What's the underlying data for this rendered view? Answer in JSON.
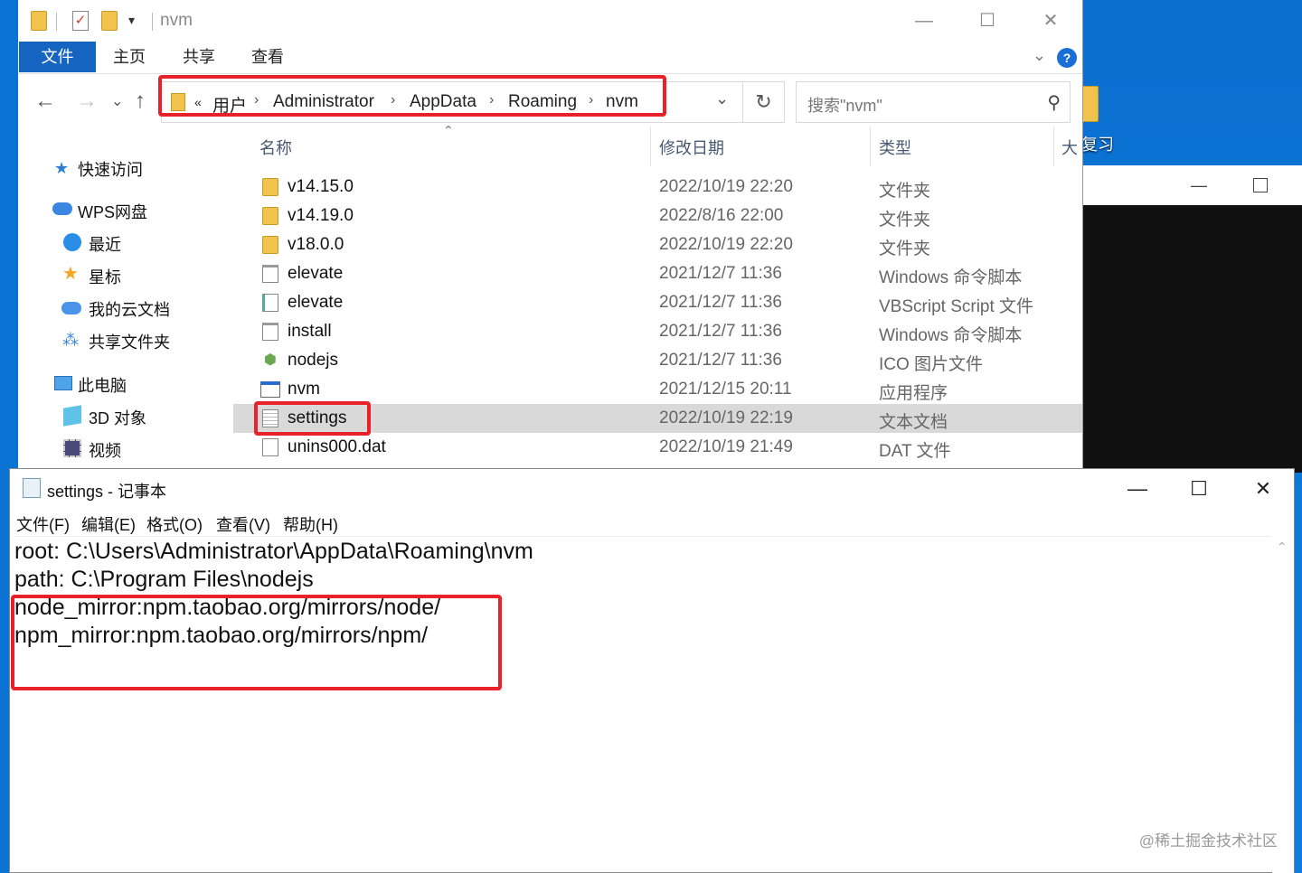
{
  "explorer": {
    "title": "nvm",
    "tabs": [
      "文件",
      "主页",
      "共享",
      "查看"
    ],
    "breadcrumb_overflow": "«",
    "breadcrumb": [
      "用户",
      "Administrator",
      "AppData",
      "Roaming",
      "nvm"
    ],
    "search_placeholder": "搜索\"nvm\"",
    "columns": {
      "name": "名称",
      "date": "修改日期",
      "type": "类型",
      "size": "大"
    },
    "sidebar": {
      "quick_access": "快速访问",
      "wps": "WPS网盘",
      "recent": "最近",
      "starred": "星标",
      "my_cloud": "我的云文档",
      "shared": "共享文件夹",
      "this_pc": "此电脑",
      "objects3d": "3D 对象",
      "videos": "视频"
    },
    "files": [
      {
        "name": "v14.15.0",
        "date": "2022/10/19 22:20",
        "type": "文件夹",
        "icon": "folder-icon"
      },
      {
        "name": "v14.19.0",
        "date": "2022/8/16 22:00",
        "type": "文件夹",
        "icon": "folder-icon"
      },
      {
        "name": "v18.0.0",
        "date": "2022/10/19 22:20",
        "type": "文件夹",
        "icon": "folder-icon"
      },
      {
        "name": "elevate",
        "date": "2021/12/7 11:36",
        "type": "Windows 命令脚本",
        "icon": "script-icon"
      },
      {
        "name": "elevate",
        "date": "2021/12/7 11:36",
        "type": "VBScript Script 文件",
        "icon": "vbscript-icon"
      },
      {
        "name": "install",
        "date": "2021/12/7 11:36",
        "type": "Windows 命令脚本",
        "icon": "script-icon"
      },
      {
        "name": "nodejs",
        "date": "2021/12/7 11:36",
        "type": "ICO 图片文件",
        "icon": "ico-icon"
      },
      {
        "name": "nvm",
        "date": "2021/12/15 20:11",
        "type": "应用程序",
        "icon": "exe-icon"
      },
      {
        "name": "settings",
        "date": "2022/10/19 22:19",
        "type": "文本文档",
        "icon": "text-file-icon"
      },
      {
        "name": "unins000.dat",
        "date": "2022/10/19 21:49",
        "type": "DAT 文件",
        "icon": "file-icon"
      }
    ]
  },
  "desktop": {
    "icon_label": "复习"
  },
  "notepad": {
    "title": "settings - 记事本",
    "menu": [
      "文件(F)",
      "编辑(E)",
      "格式(O)",
      "查看(V)",
      "帮助(H)"
    ],
    "lines": [
      "root: C:\\Users\\Administrator\\AppData\\Roaming\\nvm",
      "path: C:\\Program Files\\nodejs",
      "node_mirror:npm.taobao.org/mirrors/node/",
      "npm_mirror:npm.taobao.org/mirrors/npm/"
    ]
  },
  "watermark": "@稀土掘金技术社区",
  "colors": {
    "highlight": "#e8212a",
    "ribbon_active": "#1565c0",
    "desktop": "#0a78d7"
  }
}
